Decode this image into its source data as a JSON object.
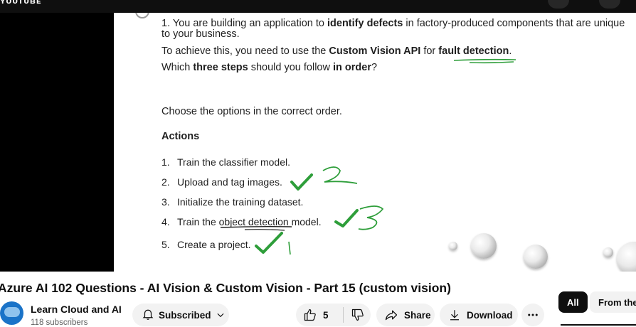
{
  "header": {
    "logo_text": "ʏᴏᴜᴛᴜʙᴇ"
  },
  "slide": {
    "q_line1_pre": "1. You are building an application to ",
    "q_line1_bold": "identify defects",
    "q_line1_post": " in factory-produced components that are unique",
    "q_line2": "to your business.",
    "q_line3_pre": "To achieve this, you need to use the ",
    "q_line3_bold1": "Custom Vision API",
    "q_line3_mid": " for ",
    "q_line3_bold2": "fault detection",
    "q_line3_post": ".",
    "q_line4_pre": "Which ",
    "q_line4_bold1": "three steps",
    "q_line4_mid": " should you follow ",
    "q_line4_bold2": "in order",
    "q_line4_post": "?",
    "instruction": "Choose the options in the correct order.",
    "actions_title": "Actions",
    "steps": [
      {
        "num": "1.",
        "text": "Train the classifier model."
      },
      {
        "num": "2.",
        "text": "Upload and tag images."
      },
      {
        "num": "3.",
        "text": "Initialize the training dataset."
      },
      {
        "num": "4.",
        "text": "Train the object detection model."
      },
      {
        "num": "5.",
        "text": "Create a project."
      }
    ],
    "annotation_color": "#2e9e3a"
  },
  "video": {
    "title": "Azure AI 102 Questions - AI Vision & Custom Vision - Part 15 (custom vision)"
  },
  "channel": {
    "name": "Learn Cloud and AI",
    "subscribers": "118 subscribers",
    "subscribe_label": "Subscribed"
  },
  "actions": {
    "like_count": "5",
    "share_label": "Share",
    "download_label": "Download"
  },
  "chips": {
    "all": "All",
    "from": "From the s"
  }
}
